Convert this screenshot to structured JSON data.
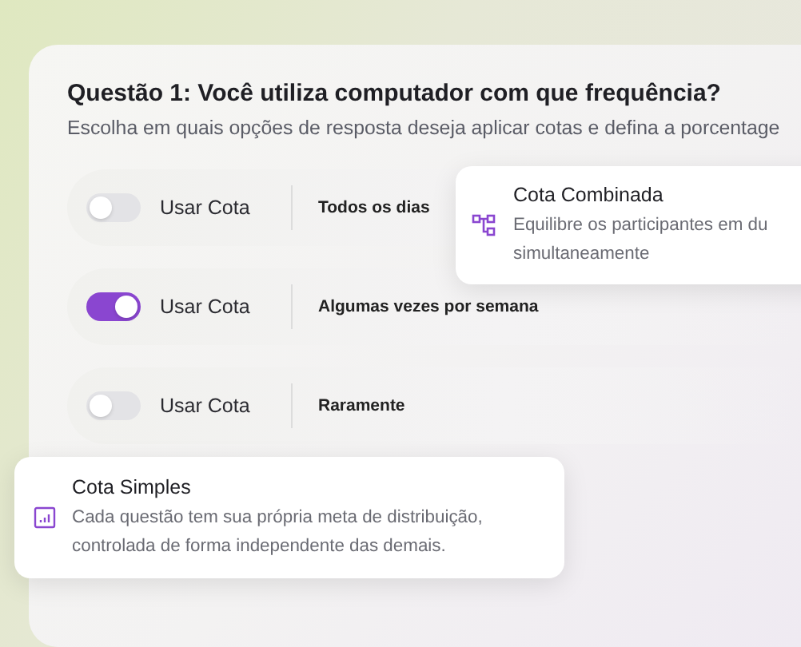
{
  "question": {
    "title": "Questão 1: Você utiliza computador com que frequência?",
    "subtitle": "Escolha em quais opções de resposta deseja aplicar cotas e defina a porcentage"
  },
  "options": [
    {
      "toggle_label": "Usar Cota",
      "on": false,
      "answer": "Todos os dias"
    },
    {
      "toggle_label": "Usar Cota",
      "on": true,
      "answer": "Algumas vezes por semana"
    },
    {
      "toggle_label": "Usar Cota",
      "on": false,
      "answer": "Raramente"
    }
  ],
  "tooltips": [
    {
      "kind": "combined",
      "title": "Cota Combinada",
      "description": "Equilibre os participantes em du\nsimultaneamente"
    },
    {
      "kind": "simple",
      "title": "Cota Simples",
      "description": "Cada questão tem sua própria meta de distribuição,\ncontrolada de forma independente das demais."
    }
  ]
}
